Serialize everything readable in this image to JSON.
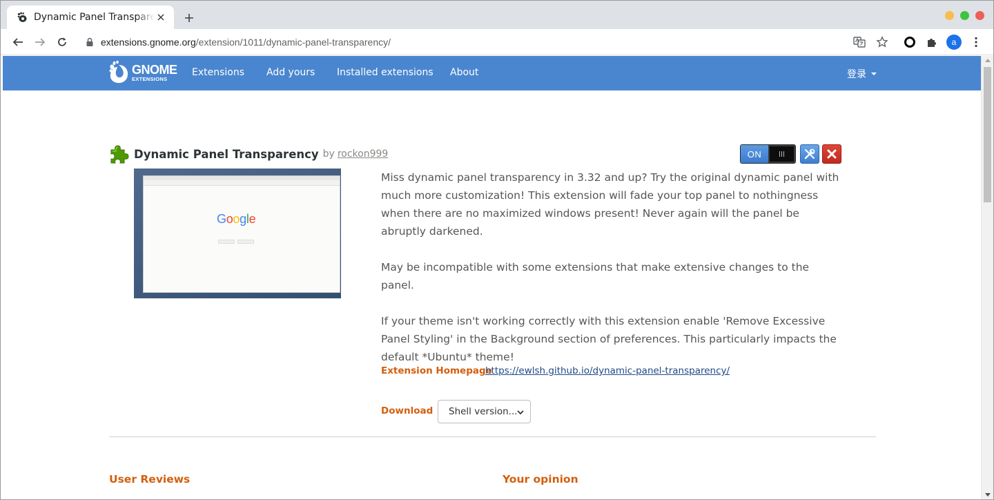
{
  "browser": {
    "tab_title": "Dynamic Panel Transparency",
    "tab_favicon": "gnome-foot-icon",
    "url_host": "extensions.gnome.org",
    "url_path": "/extension/1011/dynamic-panel-transparency/",
    "profile_initial": "a",
    "window_controls": [
      "#f5be4f",
      "#3dc43f",
      "#ed5f59"
    ]
  },
  "nav": {
    "logo_text": "GNOME",
    "logo_subtext": "EXTENSIONS",
    "links": [
      "Extensions",
      "Add yours",
      "Installed extensions",
      "About"
    ],
    "login_label": "登录"
  },
  "extension": {
    "name": "Dynamic Panel Transparency",
    "by_label": "by",
    "author": "rockon999",
    "state_label": "ON",
    "description": [
      "Miss dynamic panel transparency in 3.32 and up? Try the original dynamic panel with much more customization! This extension will fade your top panel to nothingness when there are no maximized windows present! Never again will the panel be abruptly darkened.",
      "May be incompatible with some extensions that make extensive changes to the panel.",
      "If your theme isn't working correctly with this extension enable 'Remove Excessive Panel Styling' in the Background section of preferences. This particularly impacts the default *Ubuntu* theme!"
    ],
    "homepage_label": "Extension Homepage",
    "homepage_url": "https://ewlsh.github.io/dynamic-panel-transparency/",
    "download_label": "Download",
    "shell_version_placeholder": "Shell version...",
    "screenshot_text": "Google"
  },
  "sections": {
    "reviews_title": "User Reviews",
    "opinion_title": "Your opinion"
  },
  "colors": {
    "navbar": "#4a86cf",
    "accent_orange": "#d35f0e",
    "link_blue": "#204a87"
  }
}
